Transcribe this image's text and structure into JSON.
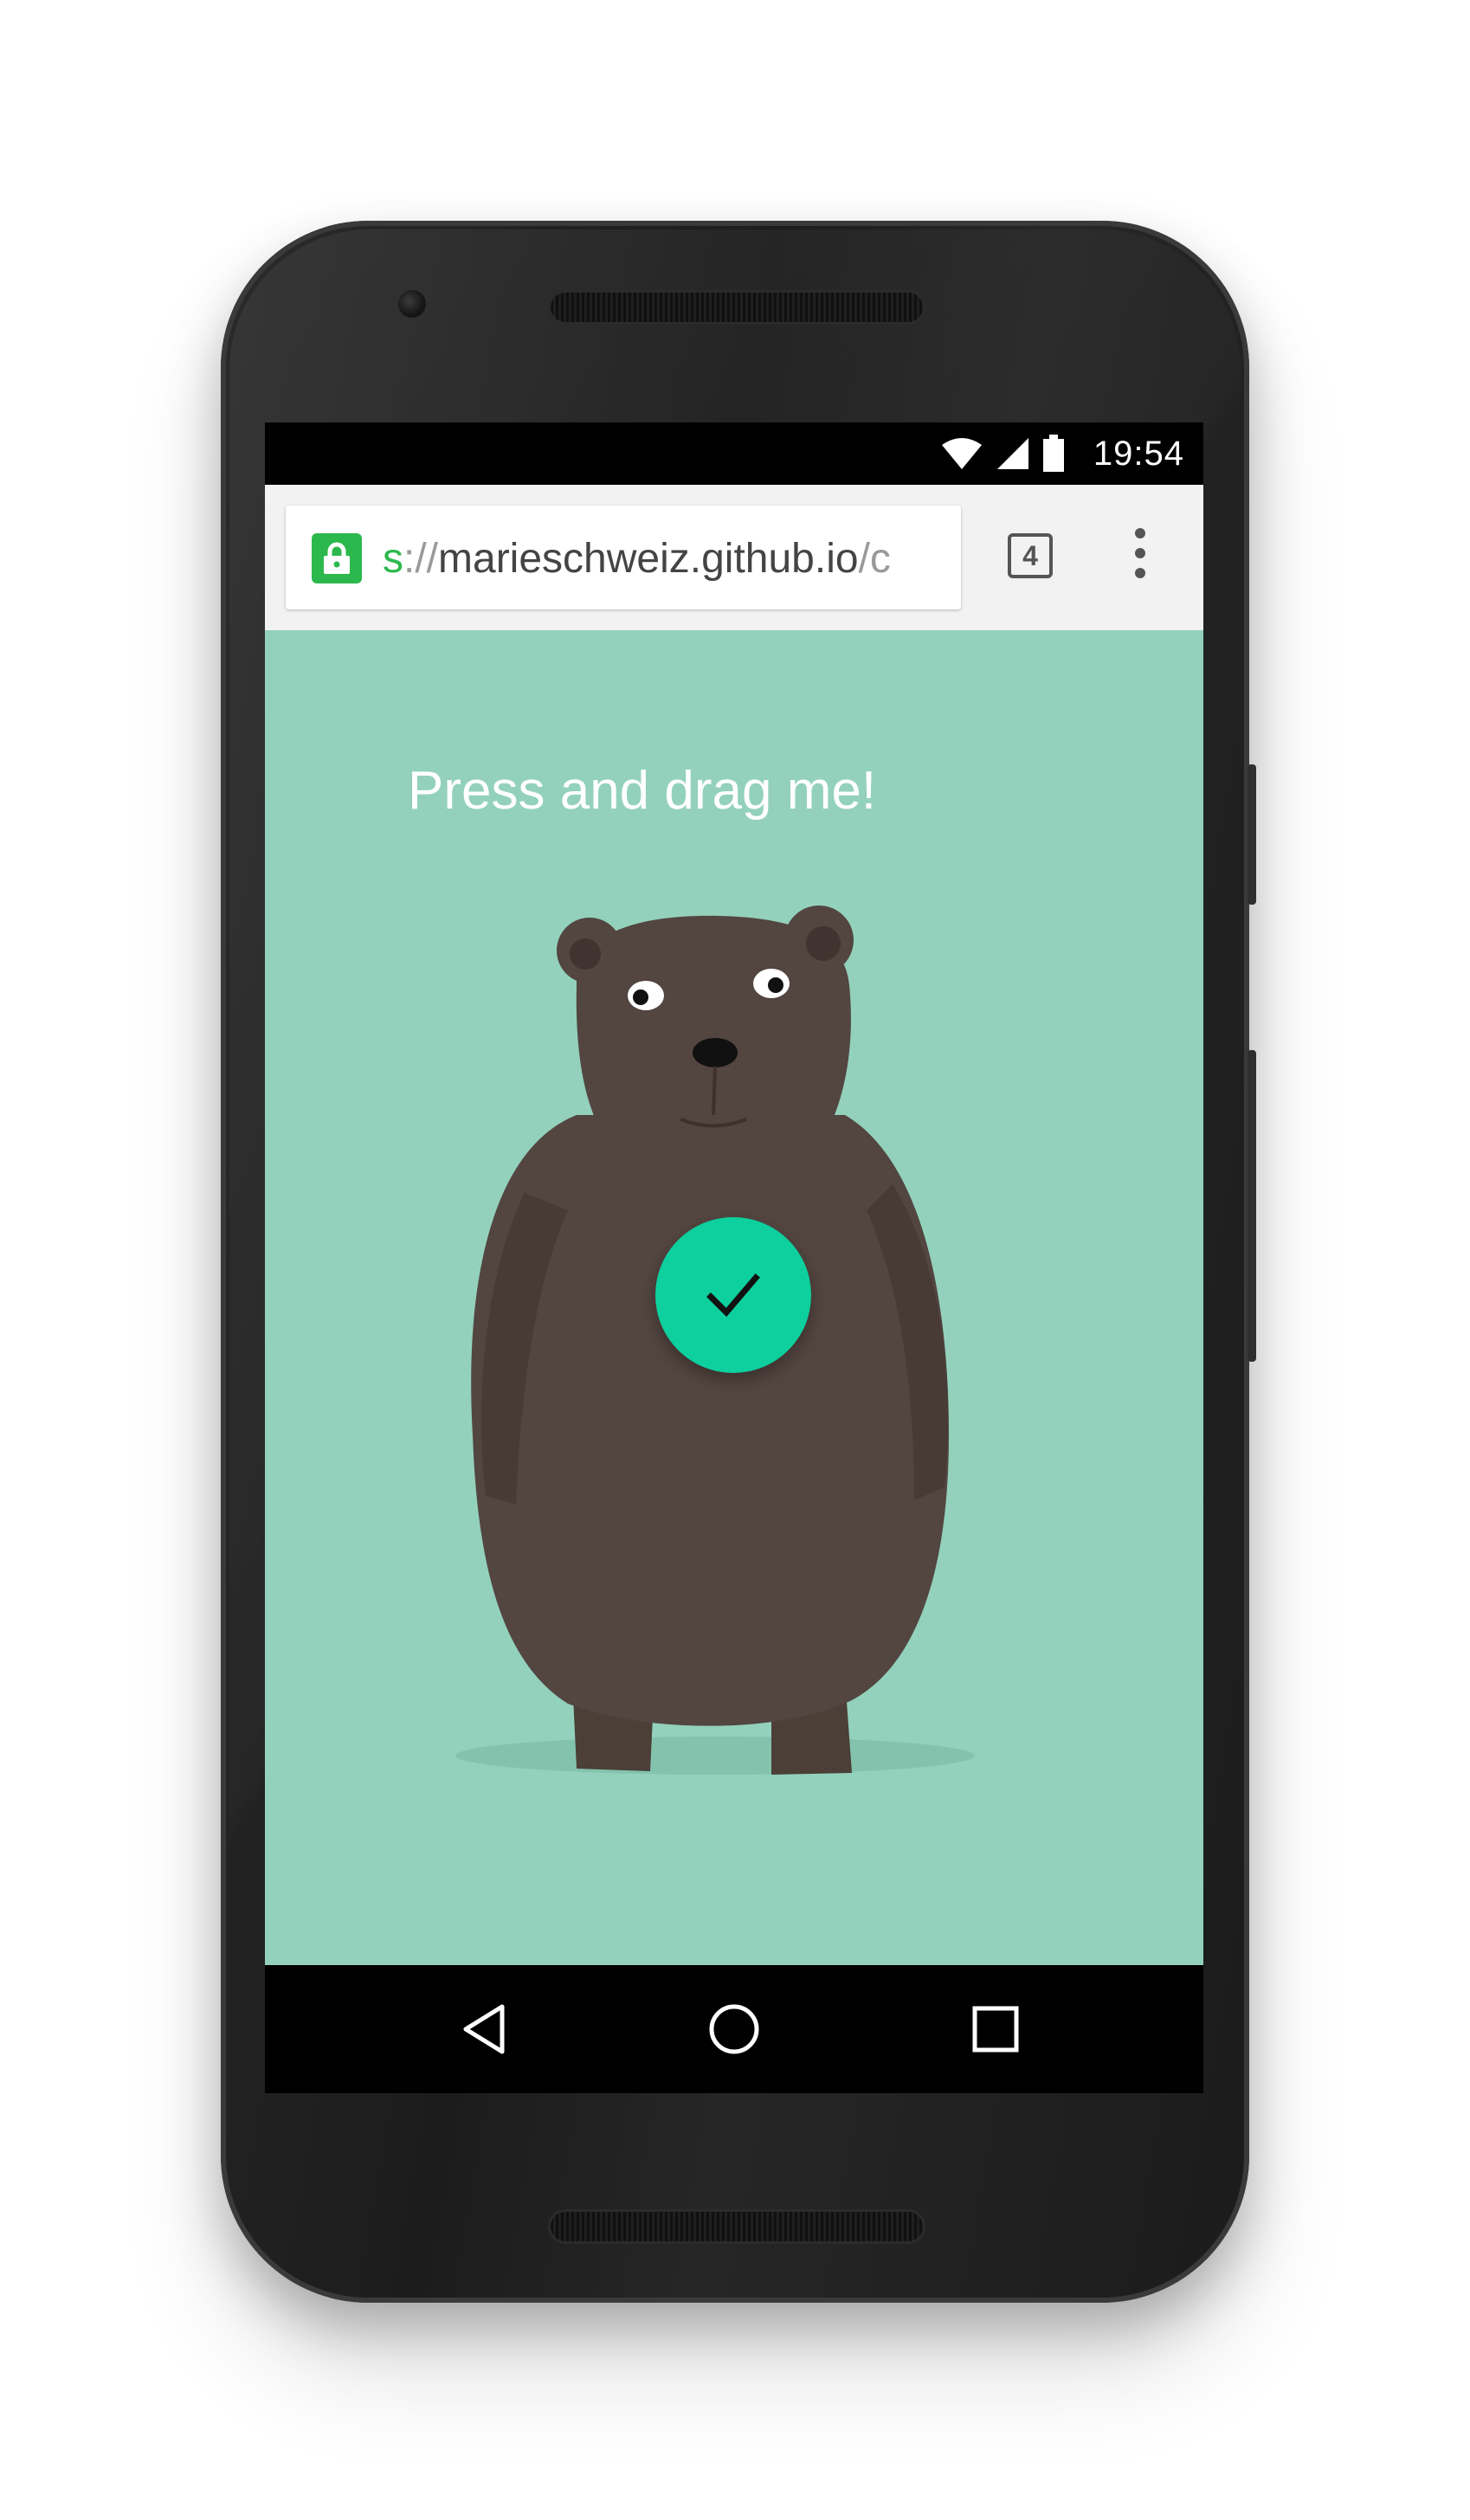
{
  "status_bar": {
    "time": "19:54",
    "icons": [
      "wifi-icon",
      "cell-signal-icon",
      "battery-icon"
    ]
  },
  "browser": {
    "url_scheme": "s",
    "url_sep": "://",
    "url_host": "marieschweiz.github.io",
    "url_rest": "/c",
    "tab_count": "4",
    "secure_color": "#2db84d"
  },
  "page": {
    "prompt": "Press and drag me!",
    "background_color": "#93d1bd",
    "fab_color": "#0ecf9e",
    "fab_icon": "check-icon"
  },
  "nav_bar": {
    "buttons": [
      "back-icon",
      "home-icon",
      "recents-icon"
    ]
  }
}
